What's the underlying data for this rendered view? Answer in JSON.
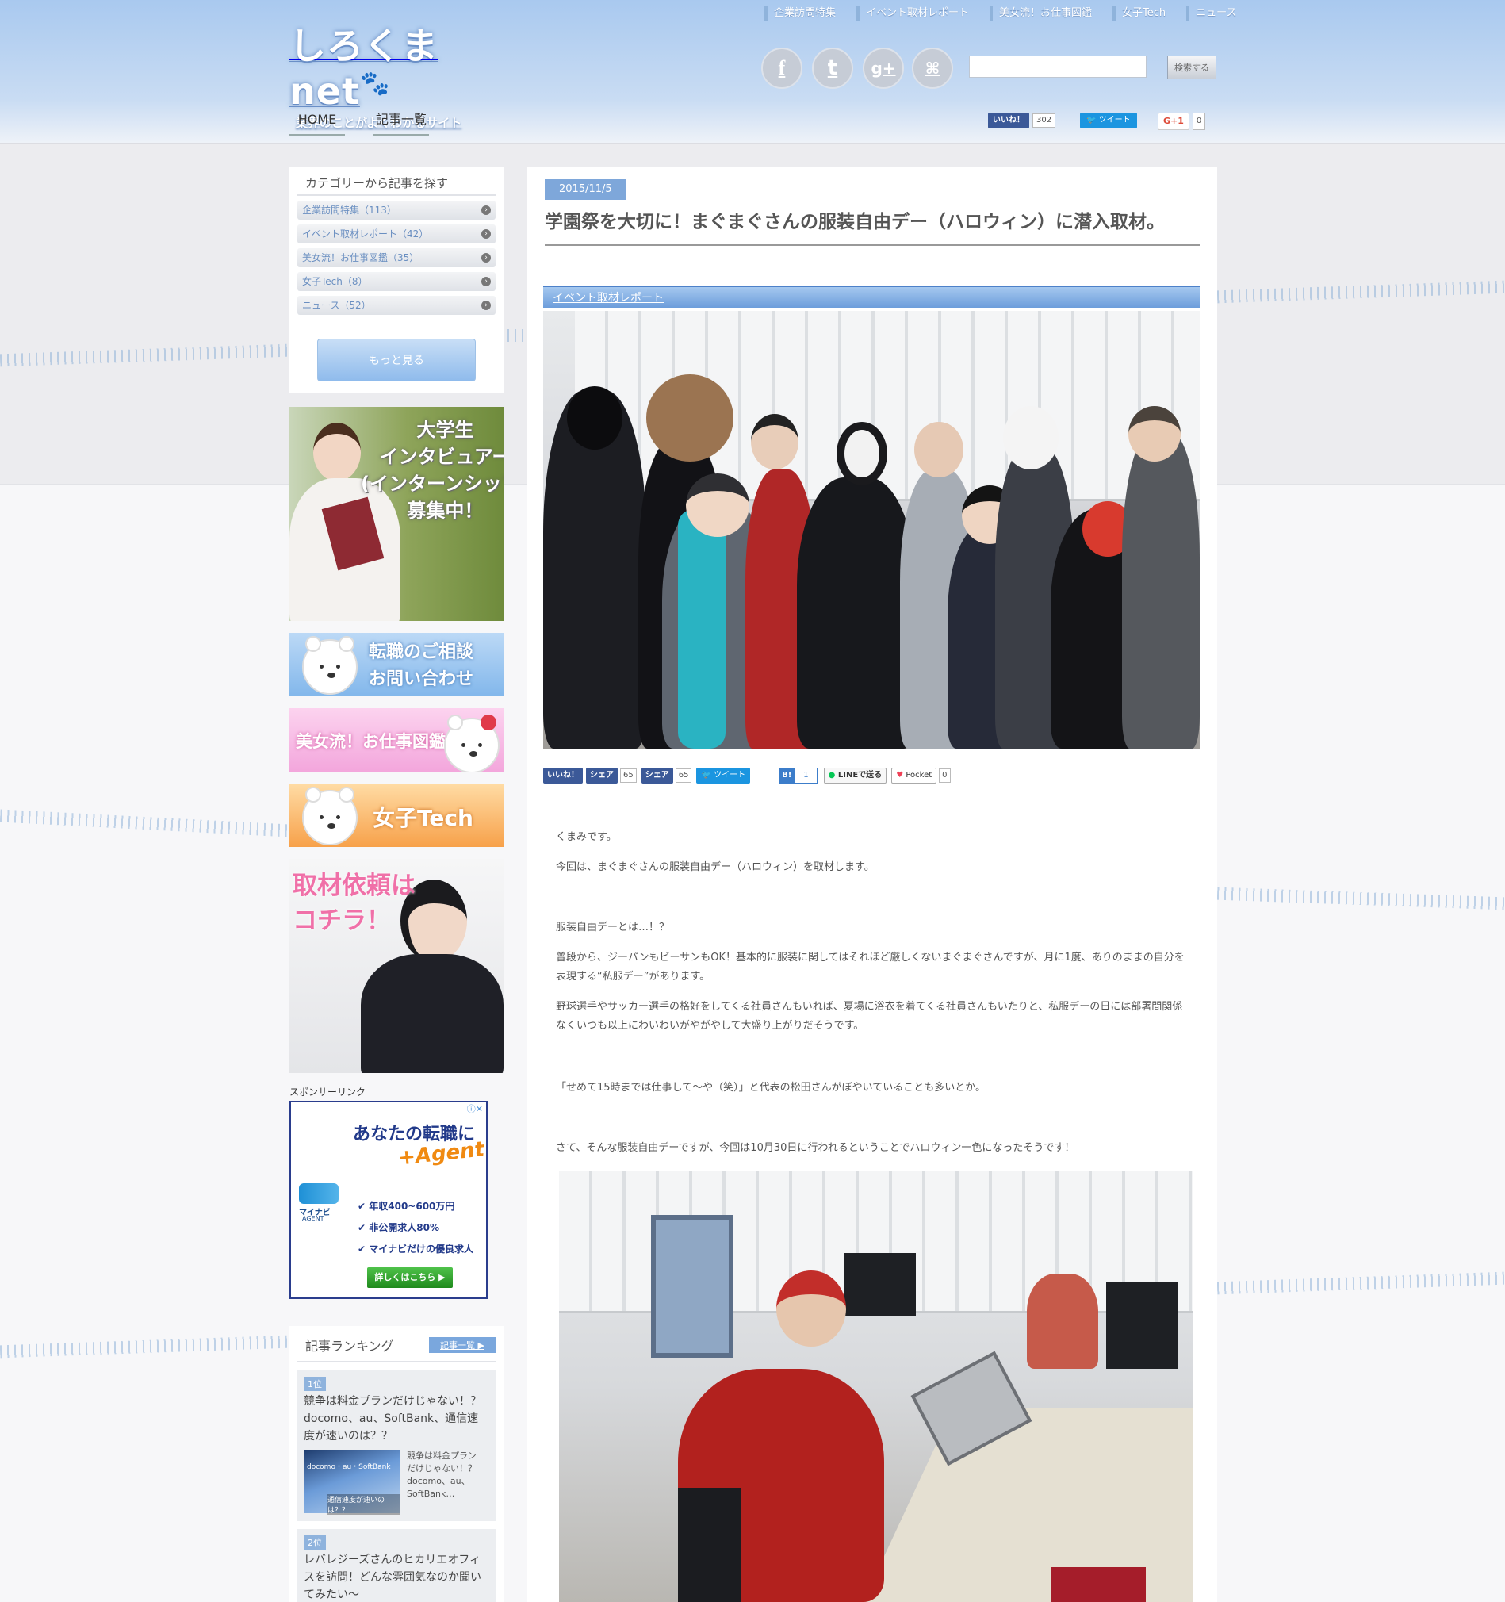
{
  "site": {
    "logo_text": "しろくまnet",
    "logo_sub": "業界のことがよくわかるサイト"
  },
  "top_nav": [
    "企業訪問特集",
    "イベント取材レポート",
    "美女流！お仕事図鑑",
    "女子Tech",
    "ニュース"
  ],
  "sns_icons": [
    "facebook-icon",
    "twitter-icon",
    "google-plus-icon",
    "rss-icon"
  ],
  "sns_glyphs": [
    "f",
    "t",
    "g+",
    "⌘"
  ],
  "search": {
    "placeholder": "",
    "button_label": "検索する"
  },
  "main_nav": [
    "HOME",
    "記事一覧"
  ],
  "header_share": {
    "fb_label": "いいね！",
    "fb_count": "302",
    "tw_label": "ツイート",
    "gp_label": "G+1",
    "gp_count": "0"
  },
  "sidebar": {
    "category_title": "カテゴリーから記事を探す",
    "categories": [
      "企業訪問特集（113）",
      "イベント取材レポート（42）",
      "美女流！お仕事図鑑（35）",
      "女子Tech（8）",
      "ニュース（52）"
    ],
    "more_label": "もっと見る",
    "banners": {
      "intern": "大学生\nインタビュアー\n(インターンシップ)\n募集中！",
      "job": "転職のご相談\nお問い合わせ",
      "bijo": "美女流！お仕事図鑑",
      "tech": "女子Tech",
      "shuzai": "取材依頼は\nコチラ！"
    },
    "sponsor_label": "スポンサーリンク",
    "ad": {
      "headline": "あなたの転職に",
      "brand": "+Agent",
      "logo": "マイナビ",
      "logo_sub": "AGENT",
      "points": [
        "年収400~600万円",
        "非公開求人80%",
        "マイナビだけの優良求人"
      ],
      "cta": "詳しくはこちら ▶"
    },
    "ranking": {
      "title": "記事ランキング",
      "link_label": "記事一覧 ▶",
      "items": [
        {
          "rank": "1位",
          "headline": "競争は料金プランだけじゃない！？docomo、au、SoftBank、通信速度が速いのは？？",
          "thumb_text_top": "docomo・au・SoftBank",
          "thumb_text_bottom": "通信速度が速いのは？？",
          "snippet": "競争は料金プランだけじゃない！？docomo、au、SoftBank…"
        },
        {
          "rank": "2位",
          "headline": "レバレジーズさんのヒカリエオフィスを訪問！どんな雰囲気なのか聞いてみたい〜"
        }
      ]
    }
  },
  "article": {
    "date": "2015/11/5",
    "title": "学園祭を大切に！まぐまぐさんの服装自由デー（ハロウィン）に潜入取材。",
    "category": "イベント取材レポート",
    "share": {
      "fb_like": "いいね！",
      "fb_share": "シェア",
      "fb_share_count": "65",
      "fb_share2": "シェア",
      "fb_share2_count": "65",
      "tw": "ツイート",
      "hatena": "B!",
      "hatena_count": "1",
      "line": "LINEで送る",
      "pocket": "Pocket",
      "pocket_count": "0"
    },
    "paragraphs": [
      "くまみです。",
      "今回は、まぐまぐさんの服装自由デー（ハロウィン）を取材します。",
      "服装自由デーとは…！？",
      "普段から、ジーパンもビーサンもOK！基本的に服装に関してはそれほど厳しくないまぐまぐさんですが、月に1度、ありのままの自分を表現する“私服デー”があります。",
      "野球選手やサッカー選手の格好をしてくる社員さんもいれば、夏場に浴衣を着てくる社員さんもいたりと、私服デーの日には部署間関係なくいつも以上にわいわいがやがやして大盛り上がりだそうです。",
      "「せめて15時までは仕事して〜や（笑）」と代表の松田さんがぼやいていることも多いとか。",
      "さて、そんな服装自由デーですが、今回は10月30日に行われるということでハロウィン一色になったそうです！"
    ]
  }
}
